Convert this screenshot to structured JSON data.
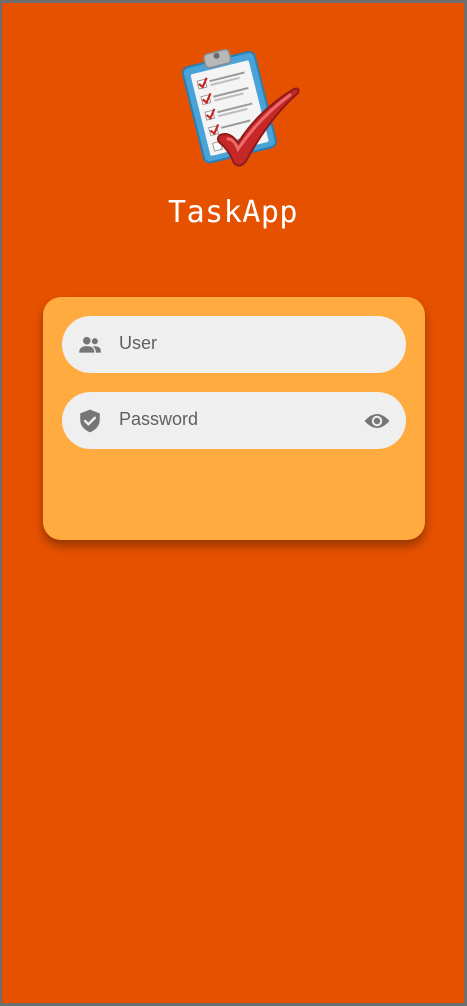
{
  "app": {
    "title": "TaskApp",
    "logo_icon": "clipboard-checklist-logo"
  },
  "login_form": {
    "user_field": {
      "placeholder": "User",
      "value": "",
      "icon": "people-icon"
    },
    "password_field": {
      "placeholder": "Password",
      "value": "",
      "icon": "shield-check-icon",
      "toggle_icon": "eye-icon"
    }
  },
  "colors": {
    "background": "#e65100",
    "card": "#ffab40",
    "field_fill": "#efefef",
    "icon": "#767676",
    "title_text": "#ffffff"
  }
}
